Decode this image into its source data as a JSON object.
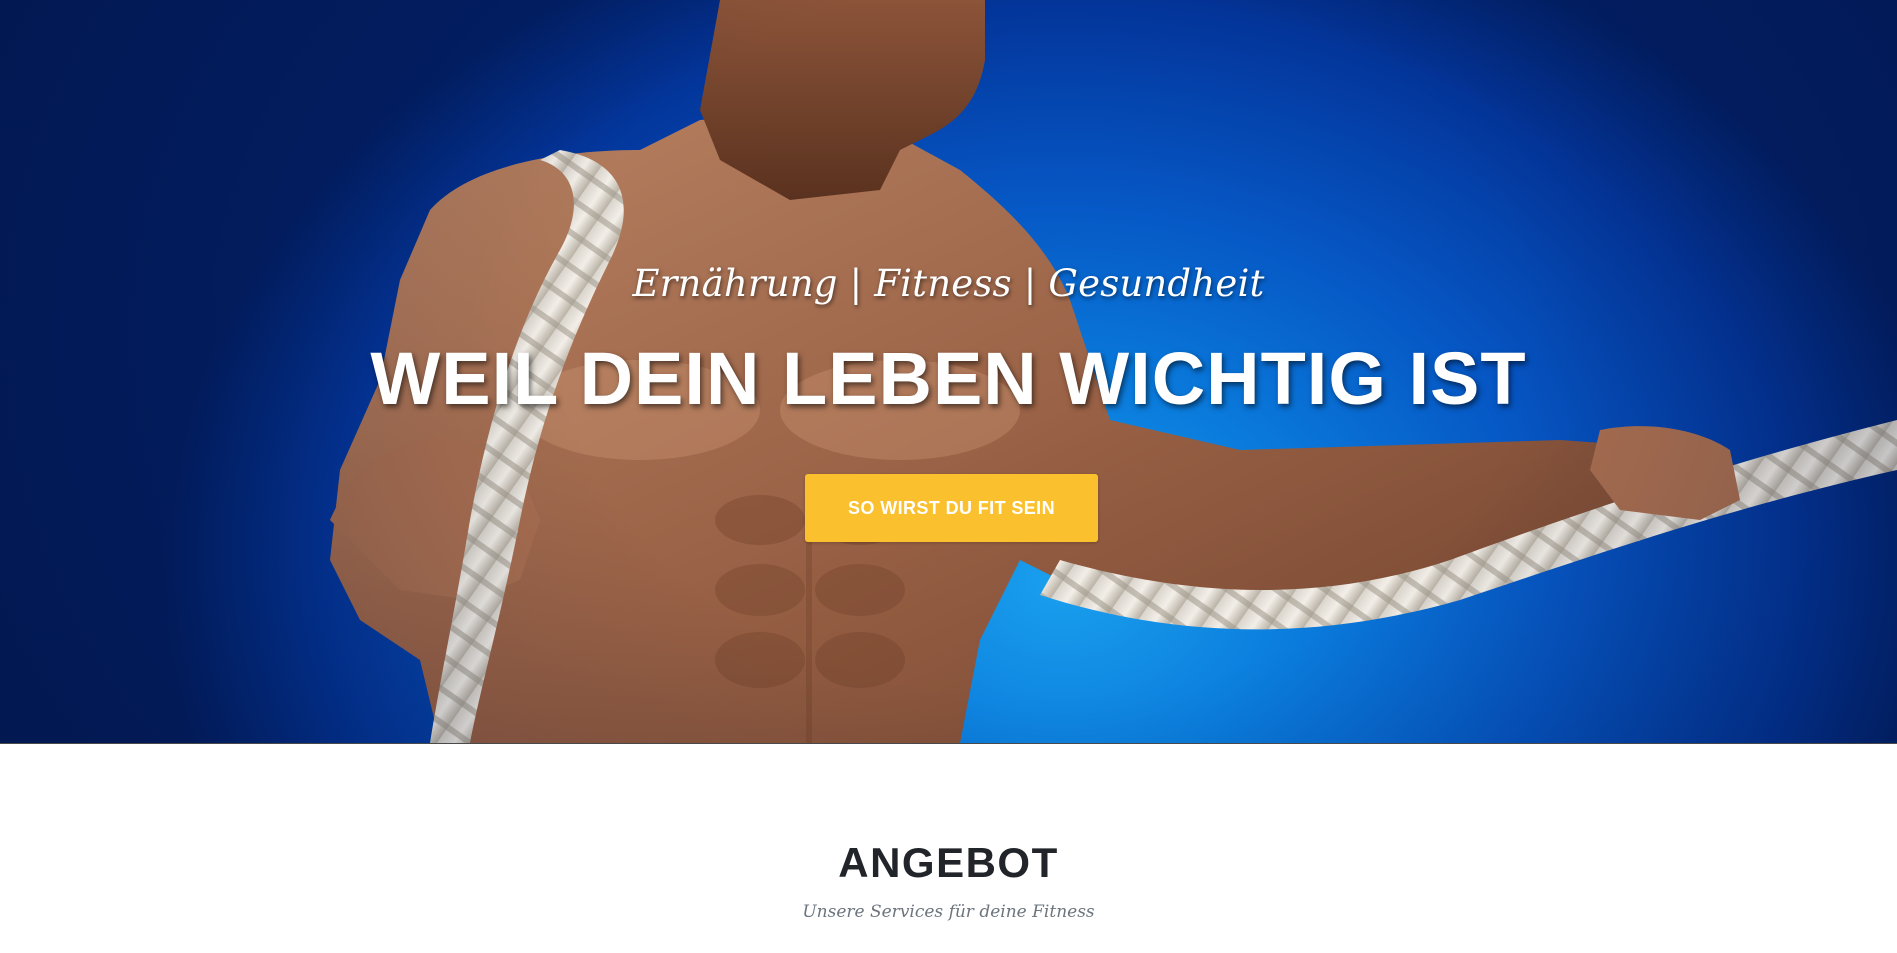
{
  "hero": {
    "subtitle": "Ernährung | Fitness | Gesundheit",
    "title": "WEIL DEIN LEBEN WICHTIG IST",
    "cta_label": "SO WIRST DU FIT SEIN",
    "background_image": "athlete-with-battle-rope-photo",
    "colors": {
      "background_blue": "#0656c4",
      "cta_yellow": "#fbc02d",
      "text": "#ffffff"
    }
  },
  "services": {
    "heading": "ANGEBOT",
    "subheading": "Unsere Services für deine Fitness",
    "colors": {
      "heading": "#212529",
      "subheading": "#6c757d"
    }
  }
}
